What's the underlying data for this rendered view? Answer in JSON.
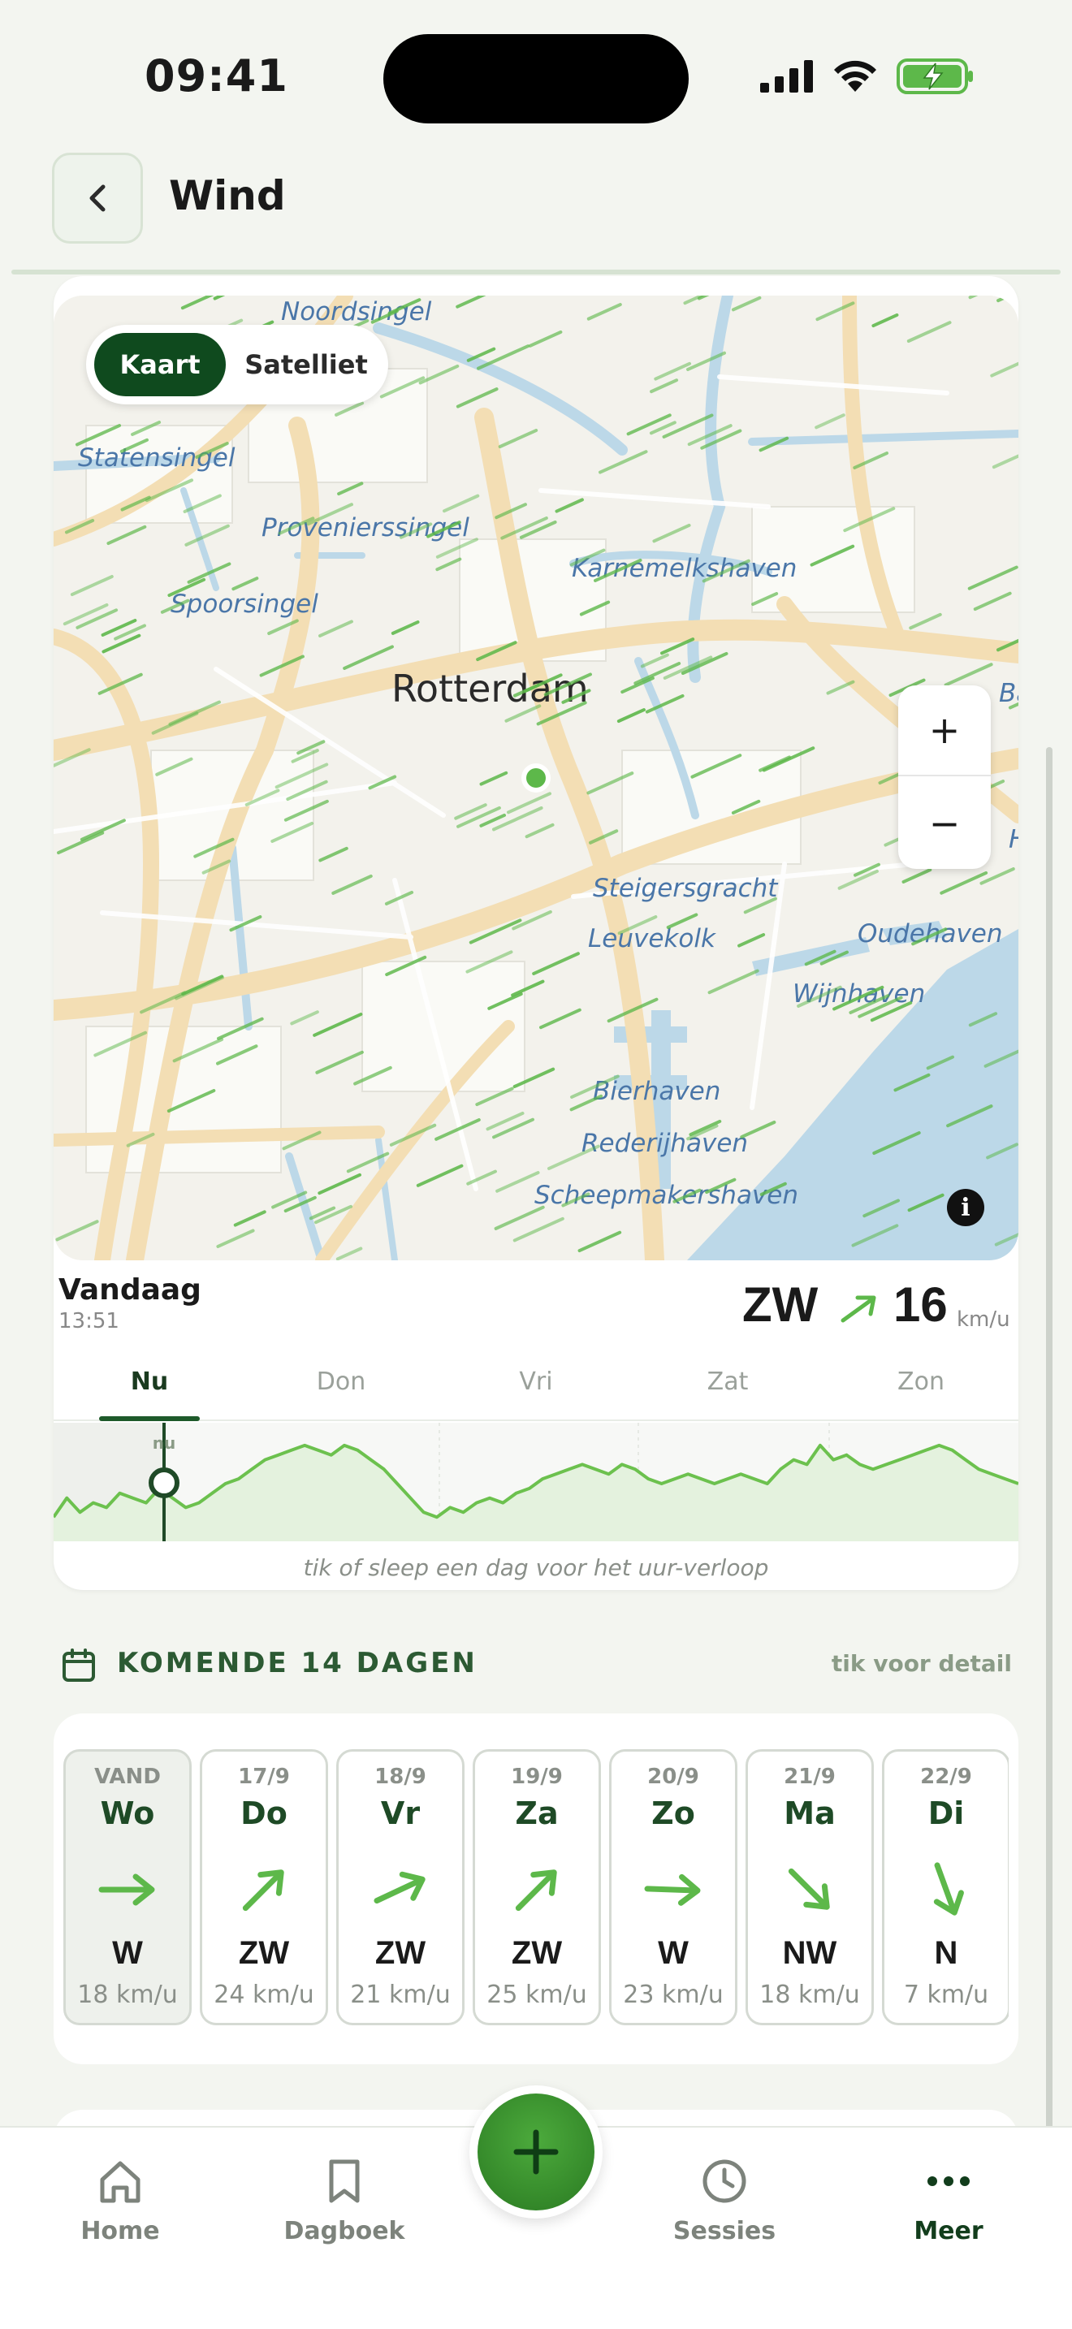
{
  "status_bar": {
    "time": "09:41"
  },
  "header": {
    "title": "Wind"
  },
  "map": {
    "toggle": {
      "kaart": "Kaart",
      "satelliet": "Satelliet"
    },
    "city_label": "Rotterdam",
    "street_labels": [
      "Noordsingel",
      "Statensingel",
      "Provenierssingel",
      "Spoorsingel",
      "Karnemelkshaven",
      "Steigersgracht",
      "Leuvekolk",
      "Oudehaven",
      "Wijnhaven",
      "Bierhaven",
      "Rederijhaven",
      "Scheepmakershaven",
      "Ba",
      "H"
    ],
    "zoom_in": "+",
    "zoom_out": "−",
    "info": "i"
  },
  "current": {
    "day": "Vandaag",
    "time": "13:51",
    "direction": "ZW",
    "speed": "16",
    "unit": "km/u"
  },
  "timeline": {
    "tabs": [
      "Nu",
      "Don",
      "Vri",
      "Zat",
      "Zon"
    ],
    "marker": "nu",
    "hint": "tik of sleep een dag voor het uur-verloop",
    "values": [
      10,
      14,
      11,
      13,
      12,
      15,
      14,
      13,
      16,
      14,
      12,
      13,
      15,
      17,
      18,
      20,
      22,
      23,
      24,
      25,
      24,
      23,
      25,
      24,
      22,
      20,
      17,
      14,
      11,
      10,
      12,
      11,
      13,
      14,
      13,
      15,
      16,
      18,
      19,
      20,
      21,
      20,
      19,
      21,
      20,
      18,
      17,
      18,
      19,
      18,
      17,
      18,
      19,
      18,
      17,
      20,
      22,
      21,
      25,
      22,
      23,
      21,
      20,
      21,
      22,
      23,
      24,
      25,
      24,
      22,
      20,
      19,
      18,
      17
    ]
  },
  "forecast": {
    "title": "KOMENDE 14 DAGEN",
    "link": "tik voor detail",
    "days": [
      {
        "date": "VAND",
        "name": "Wo",
        "dir": "W",
        "speed": "18 km/u",
        "deg": 270
      },
      {
        "date": "17/9",
        "name": "Do",
        "dir": "ZW",
        "speed": "24 km/u",
        "deg": 225
      },
      {
        "date": "18/9",
        "name": "Vr",
        "dir": "ZW",
        "speed": "21 km/u",
        "deg": 245
      },
      {
        "date": "19/9",
        "name": "Za",
        "dir": "ZW",
        "speed": "25 km/u",
        "deg": 225
      },
      {
        "date": "20/9",
        "name": "Zo",
        "dir": "W",
        "speed": "23 km/u",
        "deg": 272
      },
      {
        "date": "21/9",
        "name": "Ma",
        "dir": "NW",
        "speed": "18 km/u",
        "deg": 315
      },
      {
        "date": "22/9",
        "name": "Di",
        "dir": "N",
        "speed": "7 km/u",
        "deg": 340
      }
    ]
  },
  "nav": {
    "home": "Home",
    "dagboek": "Dagboek",
    "sessies": "Sessies",
    "meer": "Meer"
  },
  "colors": {
    "accent": "#5DB84A",
    "dark_green": "#0F4A1E",
    "text": "#1A1A1A"
  }
}
